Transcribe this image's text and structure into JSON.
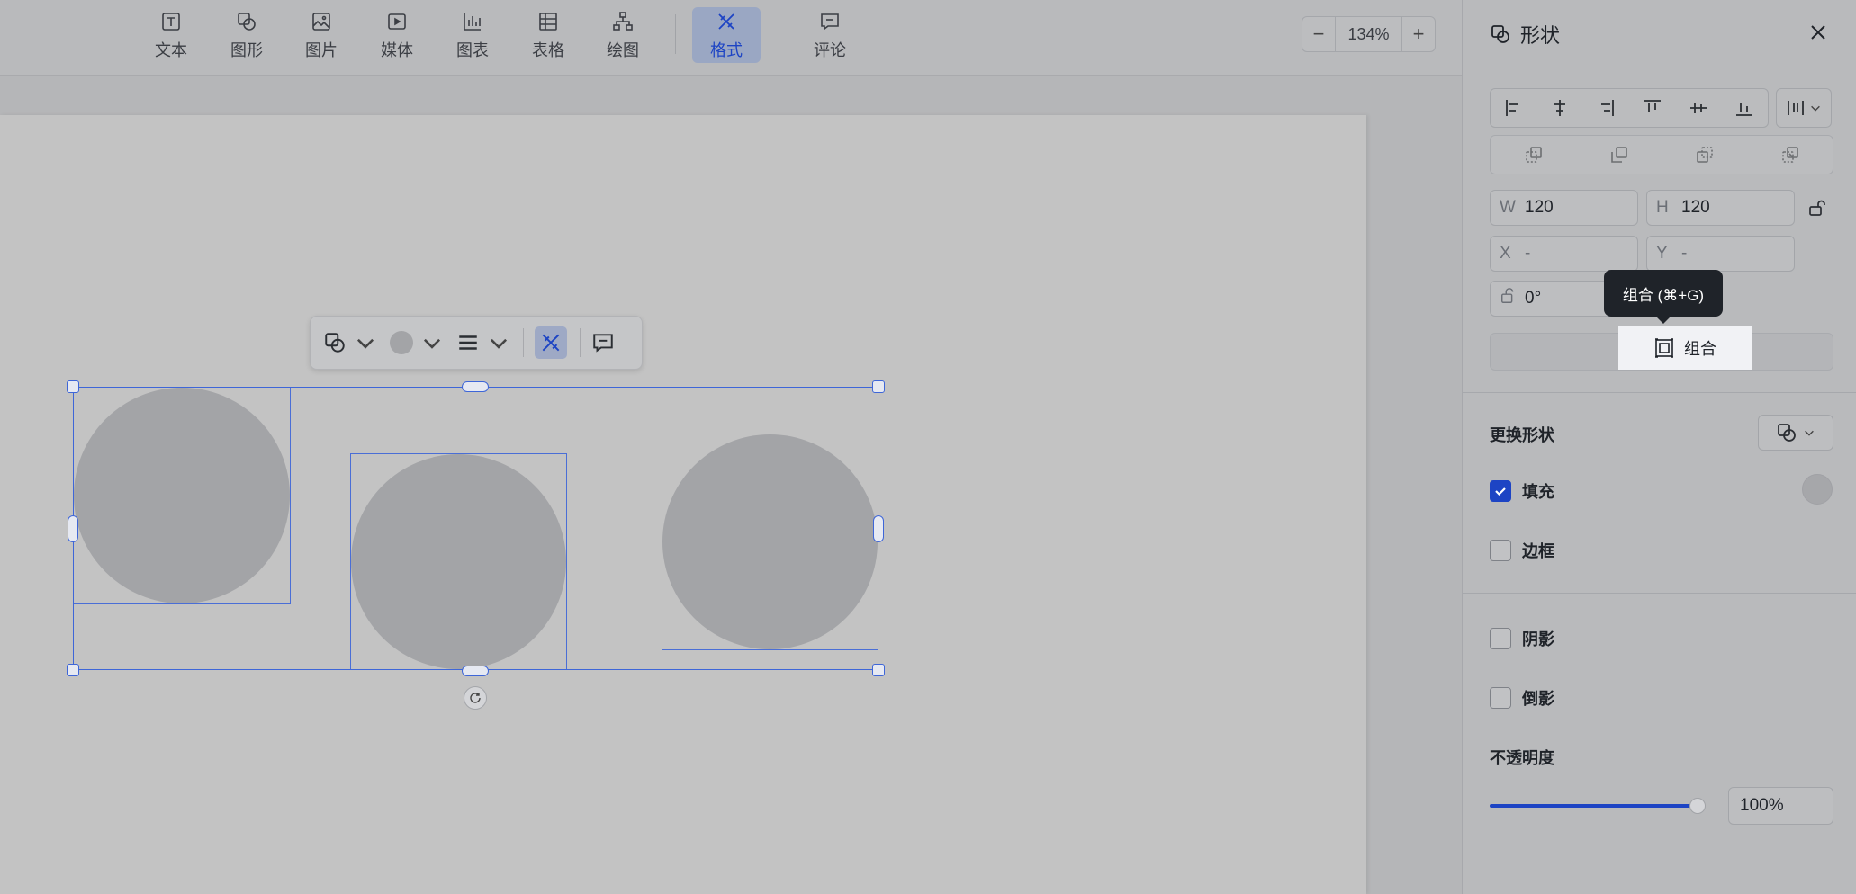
{
  "toolbar": {
    "items": [
      {
        "label": "文本",
        "icon": "text-icon"
      },
      {
        "label": "图形",
        "icon": "shape-icon"
      },
      {
        "label": "图片",
        "icon": "image-icon"
      },
      {
        "label": "媒体",
        "icon": "media-icon"
      },
      {
        "label": "图表",
        "icon": "chart-icon"
      },
      {
        "label": "表格",
        "icon": "table-icon"
      },
      {
        "label": "绘图",
        "icon": "diagram-icon"
      },
      {
        "label": "格式",
        "icon": "format-icon",
        "active": true
      },
      {
        "label": "评论",
        "icon": "comment-icon"
      }
    ],
    "zoom": {
      "minus": "−",
      "value": "134%",
      "plus": "+"
    }
  },
  "panel": {
    "title": "形状",
    "w_label": "W",
    "w_value": "120",
    "h_label": "H",
    "h_value": "120",
    "x_label": "X",
    "x_value": "-",
    "y_label": "Y",
    "y_value": "-",
    "rotation": "0°",
    "tooltip": "组合 (⌘+G)",
    "group_button": "组合",
    "change_shape": "更换形状",
    "fill": {
      "label": "填充",
      "checked": true
    },
    "border": {
      "label": "边框",
      "checked": false
    },
    "shadow": {
      "label": "阴影",
      "checked": false
    },
    "reflection": {
      "label": "倒影",
      "checked": false
    },
    "opacity_label": "不透明度",
    "opacity_value": "100%",
    "opacity_level": 1.0
  },
  "colors": {
    "accent": "#1d44c4",
    "selection": "#3e66d8",
    "shape_fill": "#a3a4a7",
    "tooltip_bg": "#1f2329"
  }
}
